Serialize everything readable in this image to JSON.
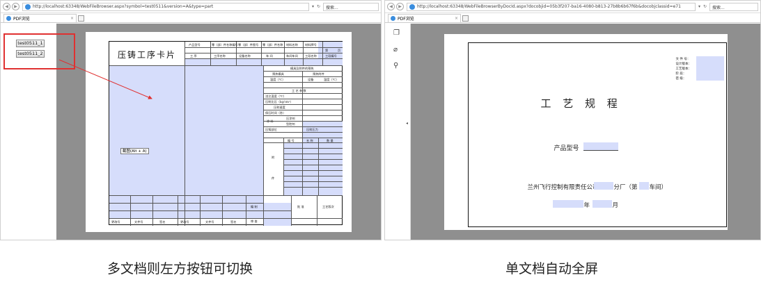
{
  "left_window": {
    "url": "http://localhost:63348/WebFileBrowser.aspx?symbol=test0511&version=A&type=part",
    "search_placeholder": "搜索...",
    "tab_title": "PDF浏览",
    "doc_buttons": [
      "test0511_1",
      "test0511_2"
    ],
    "form": {
      "title": "压铸工序卡片",
      "header_labels": [
        "产品型号",
        "零（部）件名称编号",
        "零（部）件图号",
        "零（部）件名称",
        "材料名称",
        "材料牌号"
      ],
      "header_labels_row2": [
        "第",
        "页"
      ],
      "header_labels_row3": [
        "工  序",
        "工序名称",
        "设备名称",
        "车  间",
        "车间车间",
        "工段名称",
        "工段编号"
      ],
      "mold_title": "模具及附件的预热",
      "mold_cols": [
        "预热模具",
        "预热附件"
      ],
      "mold_subcols": [
        "温度（℃）",
        "设备",
        "温度（℃）"
      ],
      "process_title": "工 艺 参 数",
      "process_rows": [
        "浇注温度（℃）",
        "压射比压（kg/cm²）",
        "压射速度",
        "保压时间（秒）",
        "涂  料",
        "压铸部位"
      ],
      "coat_cols": [
        "压涂剂",
        "型腔剂"
      ],
      "clamp_label": "压射压力",
      "acc_cols": [
        "编  号",
        "名  称",
        "数  量"
      ],
      "acc_side": [
        "附",
        "件"
      ],
      "bottom_labels": [
        "更改号",
        "文件号",
        "签名",
        "更改号",
        "文件号",
        "签名"
      ],
      "sign_labels": [
        "编  制",
        "审  查",
        "批  准",
        "工艺版次"
      ],
      "shortcut": "截图(Alt + A)"
    }
  },
  "right_window": {
    "url": "http://localhost:63348/WebFileBrowserByDocId.aspx?docobjid=05b3f207-ba16-4080-b813-27b8b6b67f6b&docobjclassid=e71",
    "search_placeholder": "搜索...",
    "tab_title": "PDF浏览",
    "doc": {
      "meta_labels": [
        "文 件 号：",
        "设计版本：",
        "工艺版本：",
        "阶    段：",
        "密    级："
      ],
      "title": "工  艺  规  程",
      "product_label": "产品型号",
      "company_line_1": "兰州飞行控制有限责任公司",
      "company_line_2": "分厂（第",
      "company_line_3": "车间）",
      "date_year": "年",
      "date_month": "月"
    }
  },
  "captions": {
    "left": "多文档则左方按钮可切换",
    "right": "单文档自动全屏"
  }
}
